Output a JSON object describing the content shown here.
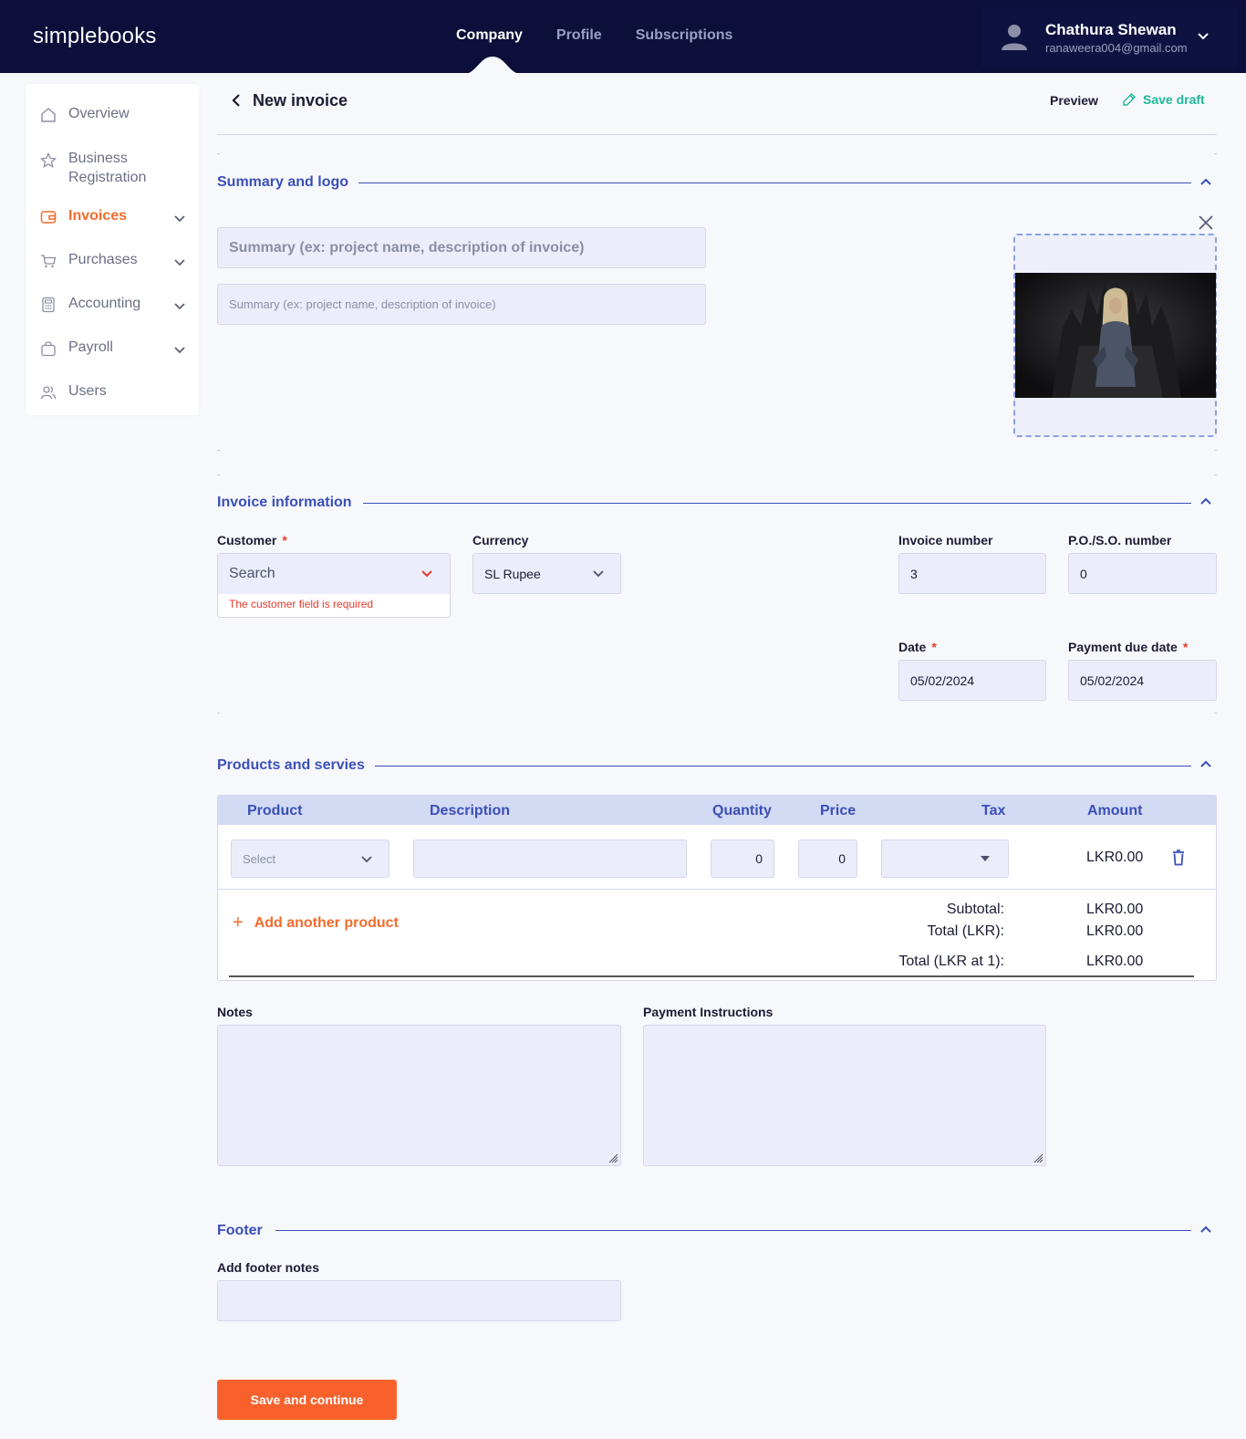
{
  "app": {
    "brand": "simplebooks",
    "nav": [
      "Company",
      "Profile",
      "Subscriptions"
    ],
    "active_nav": "Company",
    "user": {
      "name": "Chathura Shewan",
      "email": "ranaweera004@gmail.com"
    }
  },
  "sidebar": {
    "items": [
      {
        "label": "Overview",
        "icon": "home-icon",
        "expandable": false,
        "active": false
      },
      {
        "label": "Business",
        "label2": "Registration",
        "icon": "star-icon",
        "expandable": false,
        "active": false
      },
      {
        "label": "Invoices",
        "icon": "wallet-icon",
        "expandable": true,
        "active": true
      },
      {
        "label": "Purchases",
        "icon": "cart-icon",
        "expandable": true,
        "active": false
      },
      {
        "label": "Accounting",
        "icon": "calculator-icon",
        "expandable": true,
        "active": false
      },
      {
        "label": "Payroll",
        "icon": "bag-icon",
        "expandable": true,
        "active": false
      },
      {
        "label": "Users",
        "icon": "users-icon",
        "expandable": false,
        "active": false
      }
    ]
  },
  "header": {
    "title": "New invoice",
    "preview": "Preview",
    "save_draft": "Save draft"
  },
  "summary": {
    "title": "Summary and logo",
    "summary_placeholder": "Summary (ex: project name, description of invoice)",
    "description_placeholder": "Summary (ex: project name, description of invoice)"
  },
  "invoice_info": {
    "title": "Invoice information",
    "customer_label": "Customer",
    "customer_placeholder": "Search",
    "customer_error": "The customer field is required",
    "currency_label": "Currency",
    "currency_value": "SL Rupee",
    "invoice_number_label": "Invoice number",
    "invoice_number_value": "3",
    "po_label": "P.O./S.O. number",
    "po_value": "0",
    "date_label": "Date",
    "date_value": "05/02/2024",
    "due_label": "Payment due date",
    "due_value": "05/02/2024",
    "required_mark": "*"
  },
  "products": {
    "title": "Products and servies",
    "columns": [
      "Product",
      "Description",
      "Quantity",
      "Price",
      "Tax",
      "Amount"
    ],
    "row": {
      "product_placeholder": "Select",
      "description": "",
      "quantity": "0",
      "price": "0",
      "tax": "",
      "amount": "LKR0.00"
    },
    "add_label": "Add another product",
    "totals": [
      {
        "label": "Subtotal:",
        "value": "LKR0.00"
      },
      {
        "label": "Total (LKR):",
        "value": "LKR0.00"
      },
      {
        "label": "Total (LKR at 1):",
        "value": "LKR0.00"
      }
    ]
  },
  "notes": {
    "notes_label": "Notes",
    "payment_label": "Payment Instructions"
  },
  "footer": {
    "title": "Footer",
    "notes_label": "Add footer notes",
    "save_button": "Save and continue"
  },
  "colors": {
    "topbar": "#0b0f3a",
    "accent": "#f36b2c",
    "section": "#3b4fb8",
    "draft": "#1fb89a",
    "error": "#e53b2c"
  }
}
